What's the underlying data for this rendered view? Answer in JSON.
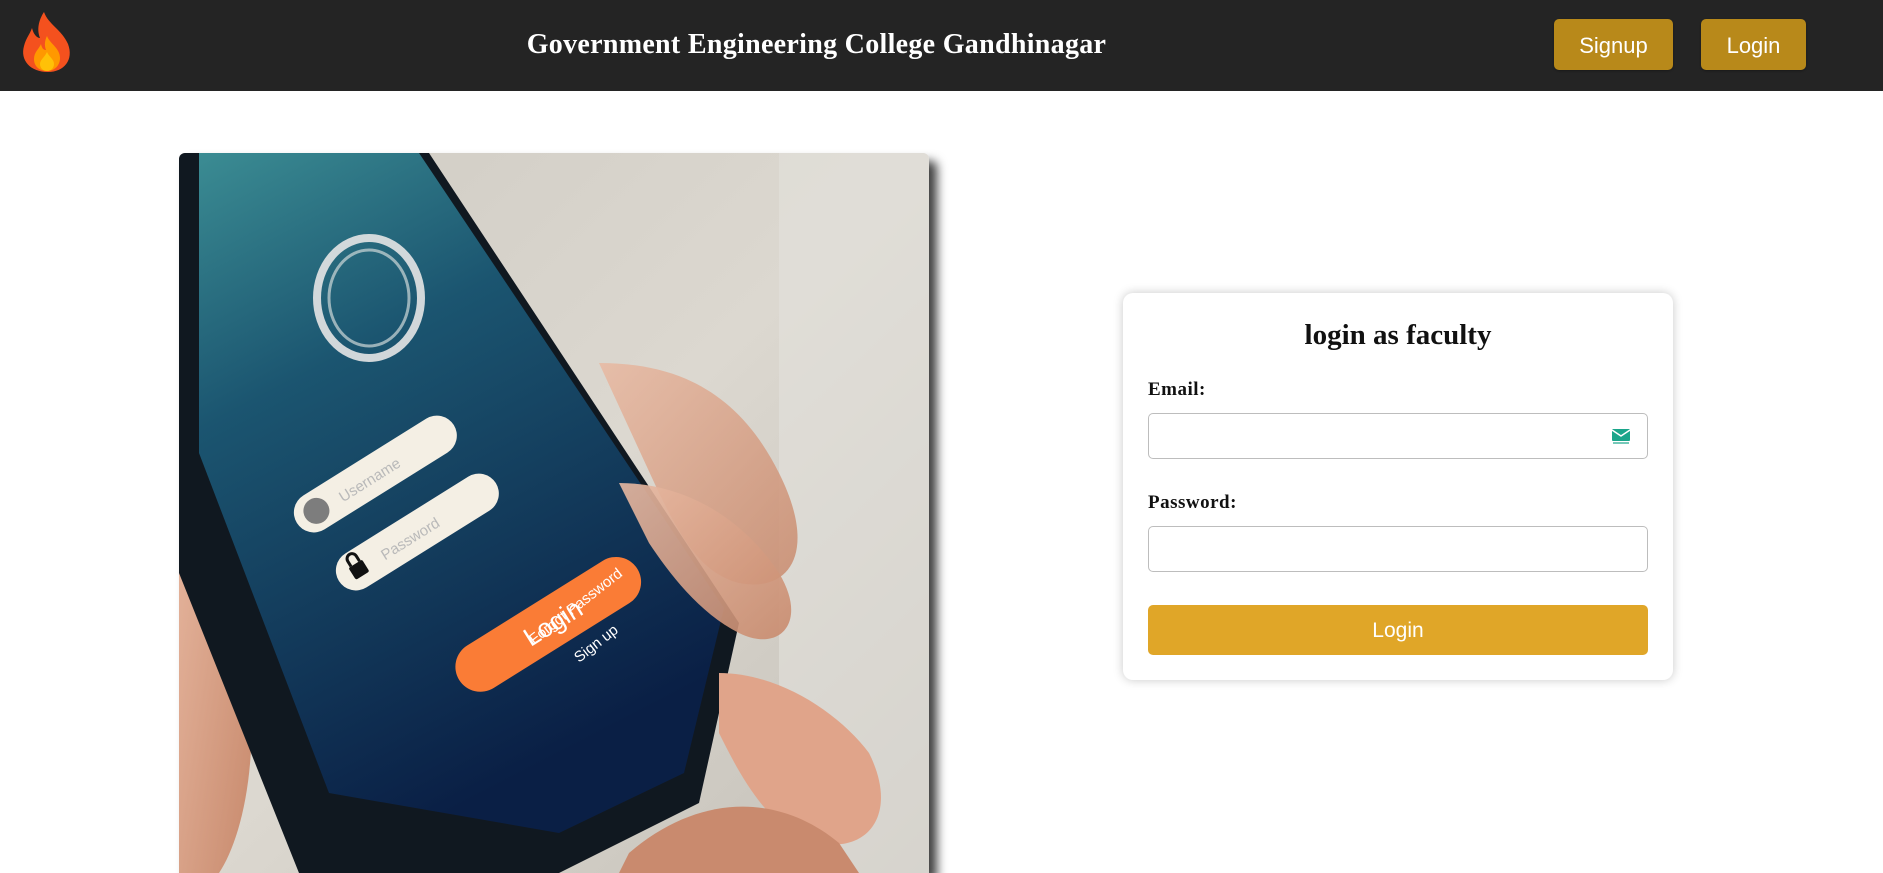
{
  "navbar": {
    "logo_icon": "flame-icon",
    "title": "Government Engineering College Gandhinagar",
    "signup_label": "Signup",
    "login_label": "Login",
    "background_color": "#242424",
    "button_color": "#b8891a"
  },
  "hero": {
    "image": "phone-login-photo",
    "phone_screen": {
      "username_placeholder": "Username",
      "password_placeholder": "Password",
      "login_label": "Login",
      "forgot_password_label": "Forgot Password",
      "signup_label": "Sign up"
    }
  },
  "login_form": {
    "title": "login as faculty",
    "email_label": "Email:",
    "email_value": "",
    "email_icon": "mail-icon",
    "password_label": "Password:",
    "password_value": "",
    "submit_label": "Login",
    "submit_color": "#e0a628"
  }
}
